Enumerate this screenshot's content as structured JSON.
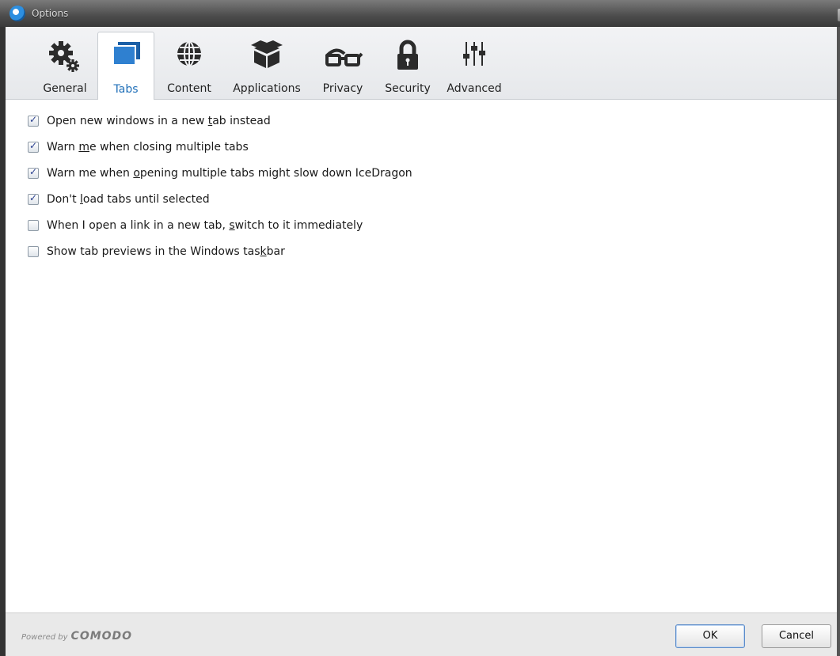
{
  "window": {
    "title": "Options"
  },
  "tabs": [
    {
      "label": "General",
      "icon": "gear-icon"
    },
    {
      "label": "Tabs",
      "icon": "tabs-icon",
      "active": true
    },
    {
      "label": "Content",
      "icon": "globe-icon"
    },
    {
      "label": "Applications",
      "icon": "box-icon"
    },
    {
      "label": "Privacy",
      "icon": "glasses-icon"
    },
    {
      "label": "Security",
      "icon": "lock-icon"
    },
    {
      "label": "Advanced",
      "icon": "sliders-icon"
    }
  ],
  "options": [
    {
      "label_pre": "Open new windows in a new ",
      "label_ul": "t",
      "label_post": "ab instead",
      "checked": true
    },
    {
      "label_pre": "Warn ",
      "label_ul": "m",
      "label_post": "e when closing multiple tabs",
      "checked": true
    },
    {
      "label_pre": "Warn me when ",
      "label_ul": "o",
      "label_post": "pening multiple tabs might slow down IceDragon",
      "checked": true
    },
    {
      "label_pre": "Don't ",
      "label_ul": "l",
      "label_post": "oad tabs until selected",
      "checked": true
    },
    {
      "label_pre": "When I open a link in a new tab, ",
      "label_ul": "s",
      "label_post": "witch to it immediately",
      "checked": false
    },
    {
      "label_pre": "Show tab previews in the Windows tas",
      "label_ul": "k",
      "label_post": "bar",
      "checked": false
    }
  ],
  "footer": {
    "powered_by": "Powered by",
    "brand": "COMODO",
    "ok_label": "OK",
    "cancel_label": "Cancel"
  },
  "colors": {
    "active_tab_text": "#1f6fb8",
    "checkbox_mark": "#2a3f8f"
  }
}
